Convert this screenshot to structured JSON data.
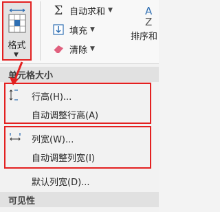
{
  "ribbon": {
    "format_button": {
      "label": "格式"
    },
    "items": [
      {
        "label": "自动求和",
        "icon": "sigma-icon"
      },
      {
        "label": "填充",
        "icon": "fill-down-icon"
      },
      {
        "label": "清除",
        "icon": "eraser-icon"
      }
    ],
    "sort_filter": {
      "label": "排序和",
      "icon_letter_top": "A",
      "icon_letter_bottom": "Z"
    }
  },
  "menu": {
    "section_cell_size": "单元格大小",
    "items": [
      {
        "label": "行高(H)...",
        "icon": "row-height-icon"
      },
      {
        "label": "自动调整行高(A)"
      },
      {
        "label": "列宽(W)...",
        "icon": "column-width-icon"
      },
      {
        "label": "自动调整列宽(I)"
      },
      {
        "label": "默认列宽(D)..."
      }
    ],
    "section_visibility": "可见性"
  },
  "colors": {
    "highlight": "#e32020",
    "accent_blue": "#2f6fb3",
    "eraser_pink": "#e0607e"
  }
}
